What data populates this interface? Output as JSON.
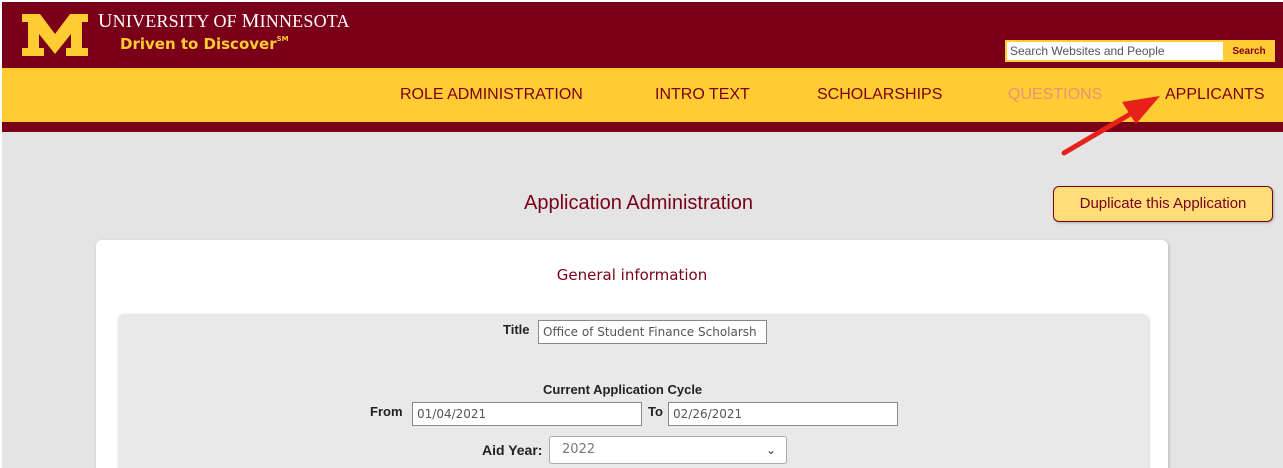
{
  "header": {
    "university_name_prefix": "U",
    "university_name_rest": "NIVERSITY OF ",
    "university_name_m": "M",
    "university_name_end": "INNESOTA",
    "tagline": "Driven to Discover",
    "tagline_mark": "SM",
    "search_placeholder": "Search Websites and People",
    "search_button": "Search"
  },
  "nav": {
    "items": [
      {
        "label": "ROLE ADMINISTRATION",
        "active": false
      },
      {
        "label": "INTRO TEXT",
        "active": false
      },
      {
        "label": "SCHOLARSHIPS",
        "active": false
      },
      {
        "label": "QUESTIONS",
        "active": true
      },
      {
        "label": "APPLICANTS",
        "active": false
      }
    ]
  },
  "main": {
    "page_title": "Application Administration",
    "duplicate_button": "Duplicate this Application",
    "section_title": "General information",
    "form": {
      "title_label": "Title",
      "title_value": "Office of Student Finance Scholarsh",
      "cycle_heading": "Current Application Cycle",
      "from_label": "From",
      "from_value": "01/04/2021",
      "to_label": "To",
      "to_value": "02/26/2021",
      "aid_year_label": "Aid Year:",
      "aid_year_value": "2022"
    }
  },
  "colors": {
    "maroon": "#7a0019",
    "gold": "#ffcc33",
    "active_nav": "#e8927c",
    "annotation_arrow": "#e8201c"
  },
  "icons": {
    "logo": "university-block-m-logo",
    "dropdown": "chevron-down-icon",
    "annotation": "red-arrow"
  }
}
